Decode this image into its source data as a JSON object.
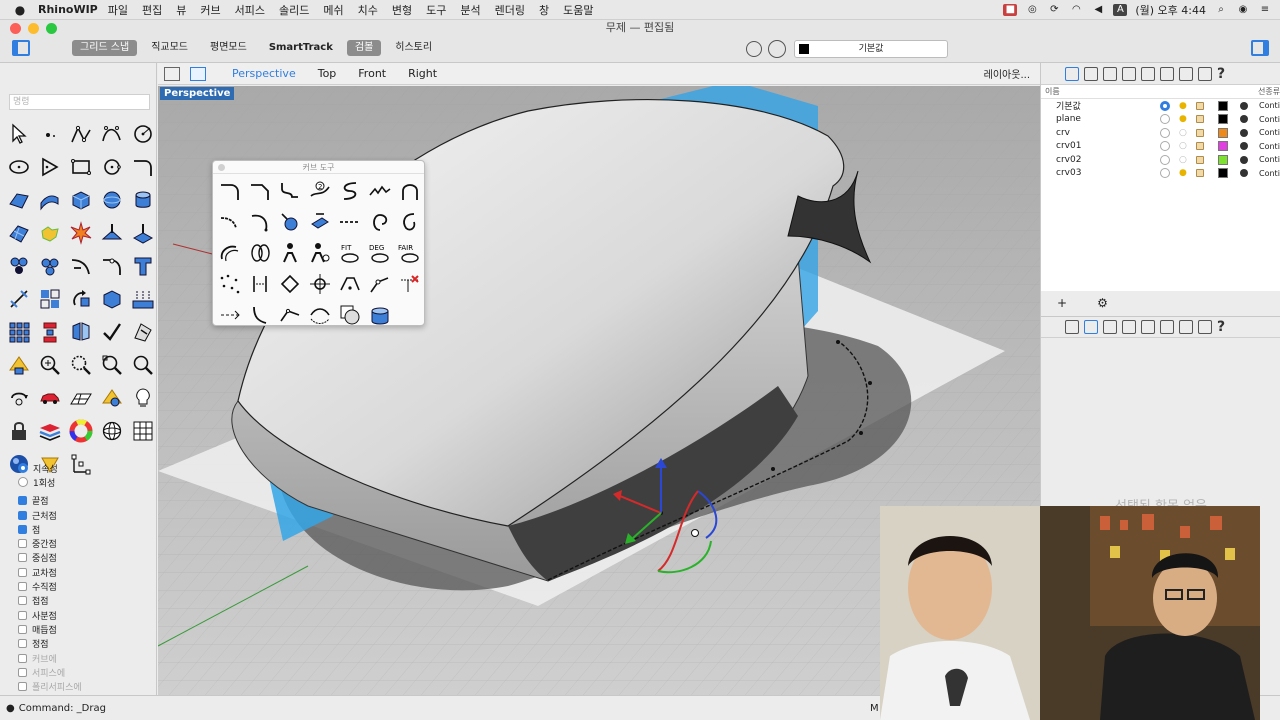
{
  "menubar": {
    "app": "RhinoWIP",
    "items": [
      "파일",
      "편집",
      "뷰",
      "커브",
      "서피스",
      "솔리드",
      "메쉬",
      "치수",
      "변형",
      "도구",
      "분석",
      "렌더링",
      "창",
      "도움말"
    ],
    "clock": "(월) 오후 4:44",
    "input_indicator": "A"
  },
  "window": {
    "title": "무제 — 편집됨"
  },
  "toolbar": {
    "modes": [
      "그리드 스냅",
      "직교모드",
      "평면모드",
      "SmartTrack",
      "검볼",
      "히스토리"
    ],
    "active_modes": [
      0,
      4
    ],
    "current_layer": "기본값"
  },
  "command": {
    "placeholder": "명령",
    "prompt": "Command: _Drag"
  },
  "viewport_tabs": {
    "tabs": [
      "Perspective",
      "Top",
      "Front",
      "Right"
    ],
    "active": "Perspective",
    "layout_label": "레이아웃..."
  },
  "viewport": {
    "label": "Perspective"
  },
  "palette": {
    "title": "커브 도구"
  },
  "snaps": {
    "modes": [
      {
        "label": "지속성",
        "kind": "radio",
        "on": true
      },
      {
        "label": "1회성",
        "kind": "radio",
        "on": false
      }
    ],
    "items": [
      {
        "label": "끝점",
        "on": true,
        "dim": false
      },
      {
        "label": "근처점",
        "on": true,
        "dim": false
      },
      {
        "label": "점",
        "on": true,
        "dim": false
      },
      {
        "label": "중간점",
        "on": false,
        "dim": false
      },
      {
        "label": "중심점",
        "on": false,
        "dim": false
      },
      {
        "label": "교차점",
        "on": false,
        "dim": false
      },
      {
        "label": "수직점",
        "on": false,
        "dim": false
      },
      {
        "label": "접점",
        "on": false,
        "dim": false
      },
      {
        "label": "사분점",
        "on": false,
        "dim": false
      },
      {
        "label": "매듭점",
        "on": false,
        "dim": false
      },
      {
        "label": "정점",
        "on": false,
        "dim": false
      },
      {
        "label": "커브에",
        "on": false,
        "dim": true
      },
      {
        "label": "서피스에",
        "on": false,
        "dim": true
      },
      {
        "label": "폴리서피스에",
        "on": false,
        "dim": true
      }
    ]
  },
  "layers": {
    "header_name": "이름",
    "header_linetype": "선종류",
    "rows": [
      {
        "name": "기본값",
        "current": true,
        "light_on": true,
        "color": "#000000",
        "linetype": "Conti"
      },
      {
        "name": "plane",
        "current": false,
        "light_on": true,
        "color": "#000000",
        "linetype": "Conti"
      },
      {
        "name": "crv",
        "current": false,
        "light_on": false,
        "color": "#ee8a1c",
        "linetype": "Conti"
      },
      {
        "name": "crv01",
        "current": false,
        "light_on": false,
        "color": "#e040e0",
        "linetype": "Conti"
      },
      {
        "name": "crv02",
        "current": false,
        "light_on": false,
        "color": "#7ee030",
        "linetype": "Conti"
      },
      {
        "name": "crv03",
        "current": false,
        "light_on": true,
        "color": "#000000",
        "linetype": "Conti"
      }
    ],
    "add_label": "+",
    "settings_label": "⚙"
  },
  "properties": {
    "empty_text": "선택된 항목 없음"
  },
  "statusbar": {
    "right_fragment": "M"
  },
  "colors": {
    "accent": "#2f7ee0",
    "viewport_bg": "#b8b8b8"
  }
}
